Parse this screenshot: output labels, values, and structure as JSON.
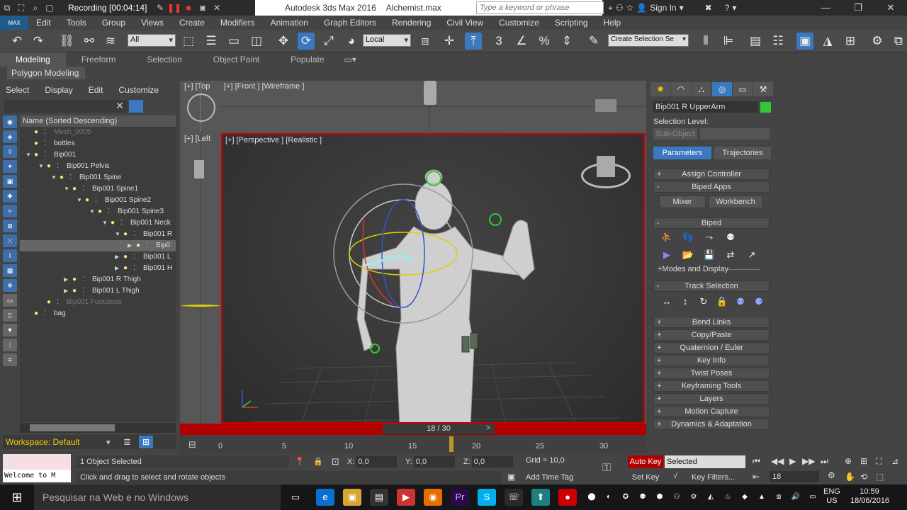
{
  "titlebar": {
    "recording": "Recording [00:04:14]",
    "app_title": "Autodesk 3ds Max 2016",
    "file_name": "Alchemist.max",
    "search_placeholder": "Type a keyword or phrase",
    "sign_in": "Sign In"
  },
  "menu": {
    "logo": "MAX",
    "items": [
      "Edit",
      "Tools",
      "Group",
      "Views",
      "Create",
      "Modifiers",
      "Animation",
      "Graph Editors",
      "Rendering",
      "Civil View",
      "Customize",
      "Scripting",
      "Help"
    ]
  },
  "toolbar": {
    "selection_filter": "All",
    "ref_coord": "Local",
    "snap_label": "3",
    "named_selection": "Create Selection Se"
  },
  "ribbon": {
    "tabs": [
      "Modeling",
      "Freeform",
      "Selection",
      "Object Paint",
      "Populate"
    ],
    "sub_label": "Polygon Modeling"
  },
  "scene": {
    "menu": [
      "Select",
      "Display",
      "Edit",
      "Customize"
    ],
    "header": "Name (Sorted Descending)",
    "rows": [
      {
        "name": "Mesh_0005",
        "indent": 0,
        "dim": true,
        "arrow": ""
      },
      {
        "name": "bottles",
        "indent": 0,
        "dim": false,
        "arrow": ""
      },
      {
        "name": "Bip001",
        "indent": 0,
        "dim": false,
        "arrow": "▼"
      },
      {
        "name": "Bip001 Pelvis",
        "indent": 1,
        "dim": false,
        "arrow": "▼"
      },
      {
        "name": "Bip001 Spine",
        "indent": 2,
        "dim": false,
        "arrow": "▼"
      },
      {
        "name": "Bip001 Spine1",
        "indent": 3,
        "dim": false,
        "arrow": "▼"
      },
      {
        "name": "Bip001 Spine2",
        "indent": 4,
        "dim": false,
        "arrow": "▼"
      },
      {
        "name": "Bip001 Spine3",
        "indent": 5,
        "dim": false,
        "arrow": "▼"
      },
      {
        "name": "Bip001 Neck",
        "indent": 6,
        "dim": false,
        "arrow": "▼"
      },
      {
        "name": "Bip001 R",
        "indent": 7,
        "dim": false,
        "arrow": "▼"
      },
      {
        "name": "Bip0",
        "indent": 8,
        "dim": false,
        "arrow": "▶",
        "selected": true
      },
      {
        "name": "Bip001 L",
        "indent": 7,
        "dim": false,
        "arrow": "▶"
      },
      {
        "name": "Bip001 H",
        "indent": 7,
        "dim": false,
        "arrow": "▶"
      },
      {
        "name": "Bip001 R Thigh",
        "indent": 3,
        "dim": false,
        "arrow": "▶"
      },
      {
        "name": "Bip001 L Thigh",
        "indent": 3,
        "dim": false,
        "arrow": "▶"
      },
      {
        "name": "Bip001 Footsteps",
        "indent": 1,
        "dim": true,
        "arrow": ""
      },
      {
        "name": "bag",
        "indent": 0,
        "dim": false,
        "arrow": ""
      }
    ],
    "workspace": "Workspace: Default"
  },
  "viewports": {
    "top": "[+] [Top",
    "front": "[+] [Front ] [Wireframe ]",
    "left": "[+] [Left",
    "perspective": "[+] [Perspective ] [Realistic ]"
  },
  "timeline": {
    "frame": "18 / 30",
    "ticks": [
      "0",
      "5",
      "10",
      "15",
      "20",
      "25",
      "30"
    ]
  },
  "command_panel": {
    "object_name": "Bip001 R UpperArm",
    "selection_level": "Selection Level:",
    "sub_object": "Sub-Object",
    "tab_parameters": "Parameters",
    "tab_trajectories": "Trajectories",
    "rollouts": [
      {
        "label": "Assign Controller",
        "sign": "+"
      },
      {
        "label": "Biped Apps",
        "sign": "-"
      }
    ],
    "mixer": "Mixer",
    "workbench": "Workbench",
    "biped": "Biped",
    "modes_display": "+Modes and Display",
    "track_selection": "Track Selection",
    "lower_rollouts": [
      "Bend Links",
      "Copy/Paste",
      "Quaternion / Euler",
      "Key Info",
      "Twist Poses",
      "Keyframing Tools",
      "Layers",
      "Motion Capture",
      "Dynamics & Adaptation"
    ]
  },
  "status": {
    "maxscript": "Welcome to M",
    "objects_selected": "1 Object Selected",
    "prompt": "Click and drag to select and rotate objects",
    "x_label": "X:",
    "x_val": "0,0",
    "y_label": "Y:",
    "y_val": "0,0",
    "z_label": "Z:",
    "z_val": "0,0",
    "grid": "Grid = 10,0",
    "add_time_tag": "Add Time Tag",
    "auto_key": "Auto Key",
    "set_key": "Set Key",
    "selected": "Selected",
    "key_filters": "Key Filters...",
    "frame_field": "18"
  },
  "taskbar": {
    "search": "Pesquisar na Web e no Windows",
    "lang1": "ENG",
    "lang2": "US",
    "time": "10:59",
    "date": "18/06/2016"
  },
  "colors": {
    "accent_blue": "#3a78c0",
    "red_active": "#b10000",
    "object_color": "#31c836",
    "workspace_text": "#f0d000"
  }
}
